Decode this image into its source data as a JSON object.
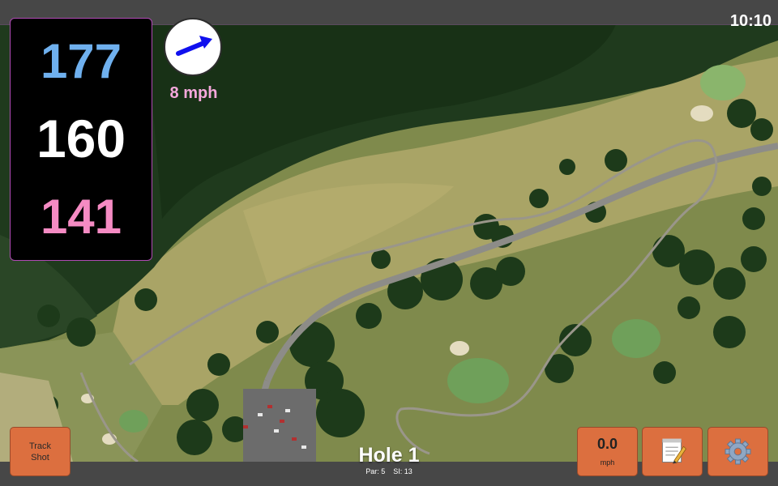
{
  "status_bar": {
    "time": "10:10"
  },
  "yardages": {
    "back": "177",
    "middle": "160",
    "front": "141",
    "colors": {
      "back": "#6fb0ee",
      "middle": "#ffffff",
      "front": "#f58bc3"
    }
  },
  "wind": {
    "speed_label": "8 mph",
    "arrow_color": "#1010ee",
    "icon": "wind-direction-arrow-icon"
  },
  "hole": {
    "title": "Hole 1",
    "par_label": "Par: 5",
    "si_label": "SI: 13"
  },
  "buttons": {
    "track_shot_line1": "Track",
    "track_shot_line2": "Shot",
    "speed_value": "0.0",
    "speed_unit": "mph",
    "notes_icon": "notepad-icon",
    "settings_icon": "gear-icon",
    "accent": "#dc6f3f"
  },
  "map": {
    "type": "satellite-aerial-golf-course"
  }
}
